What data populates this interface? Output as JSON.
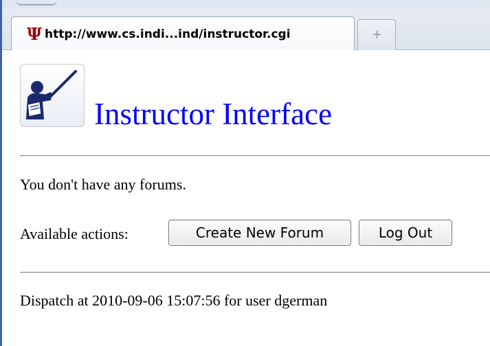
{
  "browser": {
    "tab_title": "http://www.cs.indi...ind/instructor.cgi",
    "tab_icon": "indiana-university-trident-icon",
    "tab_icon_color": "#990000",
    "new_tab_glyph": "+"
  },
  "page": {
    "logo_icon": "instructor-pointer-icon",
    "title": "Instructor Interface",
    "title_color": "#0000ff",
    "message": "You don't have any forums.",
    "actions_label": "Available actions:",
    "buttons": {
      "create_forum": "Create New Forum",
      "log_out": "Log Out"
    },
    "dispatch": "Dispatch at 2010-09-06 15:07:56 for user dgerman"
  }
}
